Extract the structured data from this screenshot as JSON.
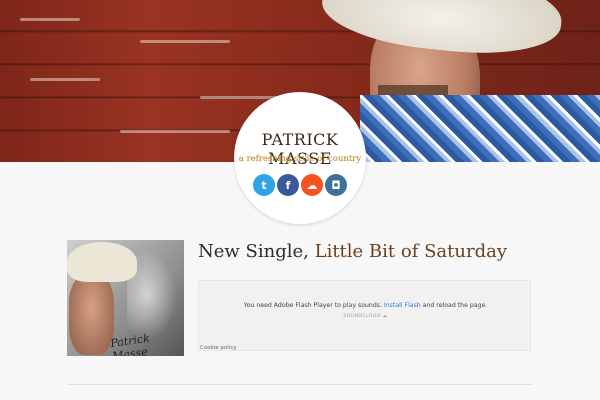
{
  "site": {
    "name": "PATRICK MASSE",
    "tagline": "a refreshing style of country"
  },
  "social": [
    {
      "icon": "twitter-icon",
      "glyph": "t"
    },
    {
      "icon": "facebook-icon",
      "glyph": "f"
    },
    {
      "icon": "soundcloud-icon",
      "glyph": "☁"
    },
    {
      "icon": "instagram-icon",
      "glyph": "◘"
    }
  ],
  "post": {
    "title_prefix": "New Single,",
    "title_highlight": "Little Bit of Saturday",
    "album_caption": "Patrick Masse"
  },
  "player": {
    "message_before": "You need Adobe Flash Player to play sounds.",
    "message_link": "Install Flash",
    "message_after": "and reload the page.",
    "brand": "SOUNDCLOUD ☁",
    "cookie_policy": "Cookie policy"
  },
  "colors": {
    "accent_brown": "#6b3f1d",
    "tagline_gold": "#b27a00",
    "twitter": "#2fa3e6",
    "facebook": "#3b5998",
    "soundcloud": "#f7521d",
    "instagram": "#3f729b"
  }
}
